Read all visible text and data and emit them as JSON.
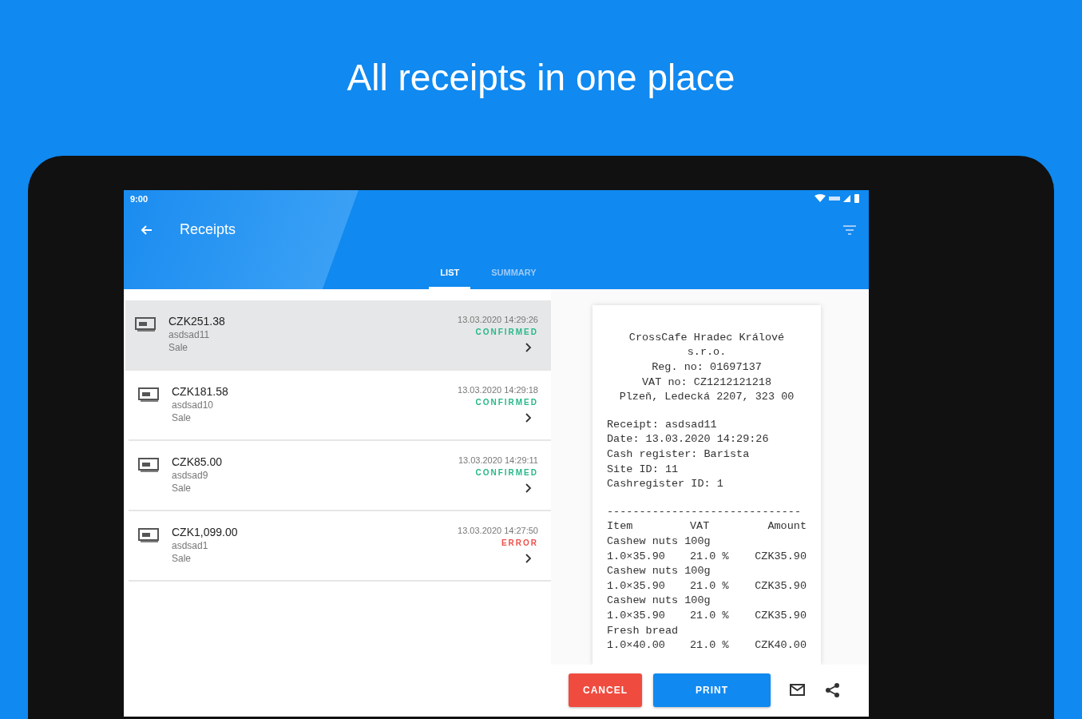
{
  "headline": "All receipts in one place",
  "status_bar": {
    "time": "9:00"
  },
  "app_bar": {
    "title": "Receipts"
  },
  "tabs": [
    {
      "label": "LIST",
      "selected": true
    },
    {
      "label": "SUMMARY",
      "selected": false
    }
  ],
  "receipts": [
    {
      "amount": "CZK251.38",
      "id": "asdsad11",
      "type": "Sale",
      "date": "13.03.2020 14:29:26",
      "status": "CONFIRMED",
      "color": "#26b889",
      "selected": true
    },
    {
      "amount": "CZK181.58",
      "id": "asdsad10",
      "type": "Sale",
      "date": "13.03.2020 14:29:18",
      "status": "CONFIRMED",
      "color": "#26b889",
      "selected": false
    },
    {
      "amount": "CZK85.00",
      "id": "asdsad9",
      "type": "Sale",
      "date": "13.03.2020 14:29:11",
      "status": "CONFIRMED",
      "color": "#26b889",
      "selected": false
    },
    {
      "amount": "CZK1,099.00",
      "id": "asdsad1",
      "type": "Sale",
      "date": "13.03.2020 14:27:50",
      "status": "ERROR",
      "color": "#f0504a",
      "selected": false
    }
  ],
  "receipt": {
    "header": [
      "CrossCafe Hradec Králové",
      "s.r.o.",
      "Reg. no: 01697137",
      "VAT no: CZ1212121218",
      "Plzeň, Ledecká 2207, 323 00"
    ],
    "info": [
      "Receipt: asdsad11",
      "Date: 13.03.2020 14:29:26",
      "Cash register: Barista",
      "Site ID: 11",
      "Cashregister ID: 1"
    ],
    "separator": "------------------------------",
    "columns": [
      "Item",
      "VAT",
      "Amount"
    ],
    "items": [
      {
        "name": "Cashew nuts 100g",
        "quantity": "1.0×35.90",
        "vat": "21.0 %",
        "amount": "CZK35.90"
      },
      {
        "name": "Cashew nuts 100g",
        "quantity": "1.0×35.90",
        "vat": "21.0 %",
        "amount": "CZK35.90"
      },
      {
        "name": "Cashew nuts 100g",
        "quantity": "1.0×35.90",
        "vat": "21.0 %",
        "amount": "CZK35.90"
      },
      {
        "name": "Fresh bread",
        "quantity": "1.0×40.00",
        "vat": "21.0 %",
        "amount": "CZK40.00"
      }
    ]
  },
  "actions": {
    "cancel": "CANCEL",
    "print": "PRINT"
  }
}
